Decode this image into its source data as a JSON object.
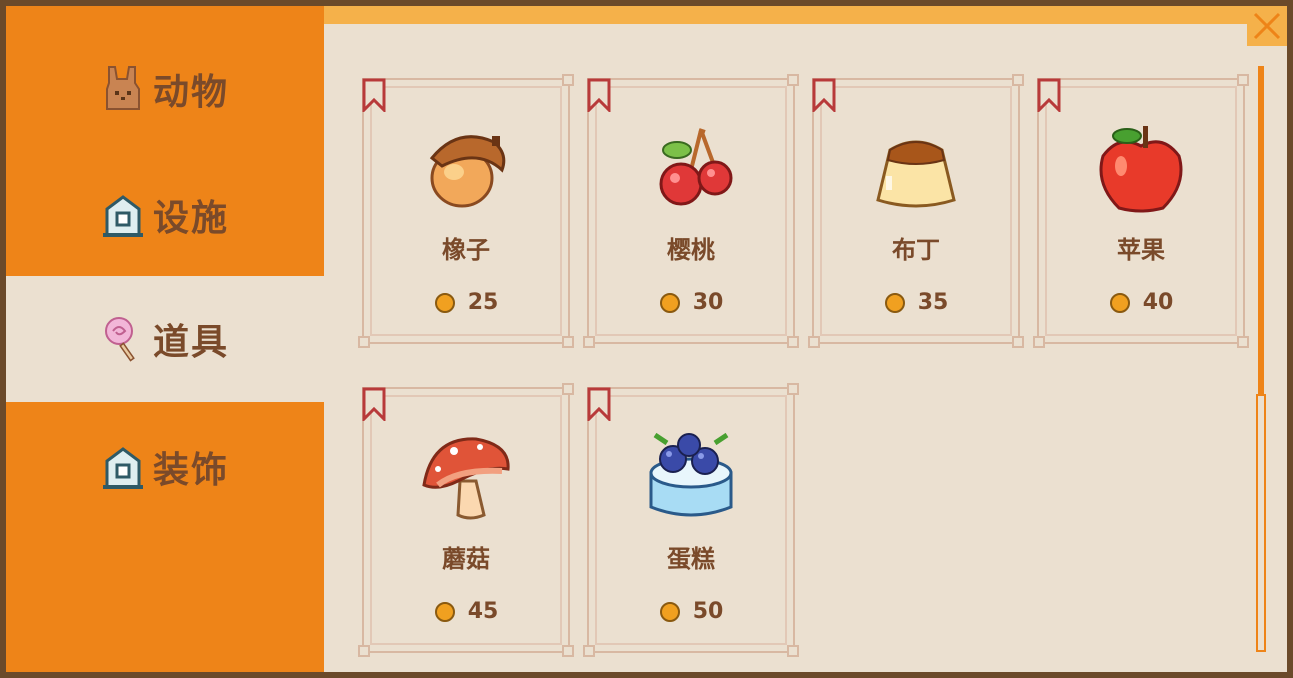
{
  "sidebar": {
    "tabs": [
      {
        "label": "动物",
        "icon": "rabbit-icon",
        "active": false
      },
      {
        "label": "设施",
        "icon": "house-icon",
        "active": false
      },
      {
        "label": "道具",
        "icon": "lollipop-icon",
        "active": true
      },
      {
        "label": "装饰",
        "icon": "house-icon",
        "active": false
      }
    ]
  },
  "items": [
    {
      "name": "橡子",
      "price": "25",
      "icon": "acorn-icon"
    },
    {
      "name": "樱桃",
      "price": "30",
      "icon": "cherry-icon"
    },
    {
      "name": "布丁",
      "price": "35",
      "icon": "pudding-icon"
    },
    {
      "name": "苹果",
      "price": "40",
      "icon": "apple-icon"
    },
    {
      "name": "蘑菇",
      "price": "45",
      "icon": "mushroom-icon"
    },
    {
      "name": "蛋糕",
      "price": "50",
      "icon": "blueberry-cake-icon"
    }
  ],
  "colors": {
    "sidebar": "#ee8418",
    "panel": "#ebe0d0",
    "text": "#7a4a2a",
    "accent": "#f5b14a",
    "frame": "#6b4a2a"
  }
}
